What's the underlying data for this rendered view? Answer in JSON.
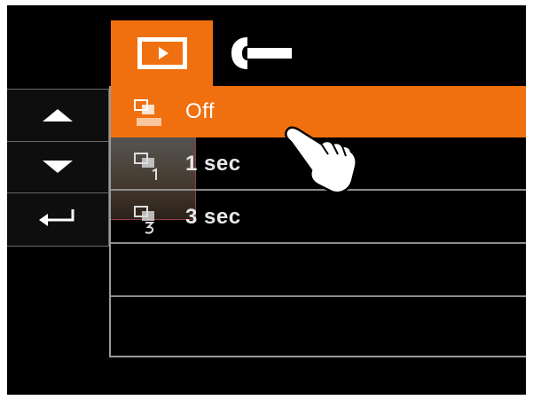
{
  "tabs": [
    {
      "name": "playback",
      "icon": "playback-icon",
      "active": true
    },
    {
      "name": "setup",
      "icon": "wrench-icon",
      "active": false
    }
  ],
  "menu": {
    "items": [
      {
        "label": "Off",
        "icon": "slideshow-off-icon",
        "selected": true
      },
      {
        "label": "1 sec",
        "icon": "slideshow-1s-icon",
        "selected": false
      },
      {
        "label": "3 sec",
        "icon": "slideshow-3s-icon",
        "selected": false
      },
      {
        "label": "",
        "selected": false
      },
      {
        "label": "",
        "selected": false
      }
    ]
  },
  "nav": {
    "up_icon": "arrow-up-icon",
    "down_icon": "arrow-down-icon",
    "enter_icon": "enter-return-icon"
  },
  "colors": {
    "accent": "#f07010",
    "background": "#000000",
    "text": "#ffffff",
    "divider": "#8c8c8c"
  }
}
